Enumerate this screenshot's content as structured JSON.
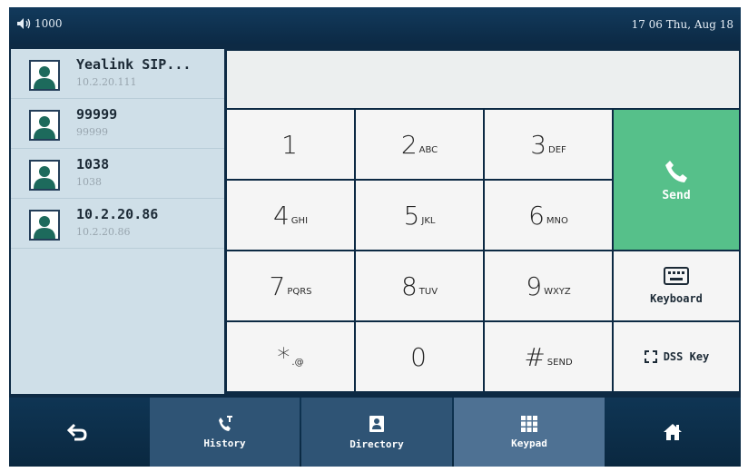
{
  "status": {
    "volume_label": "1000",
    "datetime": "17 06 Thu, Aug 18"
  },
  "contacts": [
    {
      "name": "Yealink SIP...",
      "number": "10.2.20.111"
    },
    {
      "name": "99999",
      "number": "99999"
    },
    {
      "name": "1038",
      "number": "1038"
    },
    {
      "name": "10.2.20.86",
      "number": "10.2.20.86"
    }
  ],
  "keypad": {
    "k1": {
      "digit": "1",
      "sub": ""
    },
    "k2": {
      "digit": "2",
      "sub": "ABC"
    },
    "k3": {
      "digit": "3",
      "sub": "DEF"
    },
    "k4": {
      "digit": "4",
      "sub": "GHI"
    },
    "k5": {
      "digit": "5",
      "sub": "JKL"
    },
    "k6": {
      "digit": "6",
      "sub": "MNO"
    },
    "k7": {
      "digit": "7",
      "sub": "PQRS"
    },
    "k8": {
      "digit": "8",
      "sub": "TUV"
    },
    "k9": {
      "digit": "9",
      "sub": "WXYZ"
    },
    "kstar": {
      "digit": "*",
      "sub": ".@"
    },
    "k0": {
      "digit": "0",
      "sub": ""
    },
    "khash": {
      "digit": "#",
      "sub": "SEND"
    }
  },
  "actions": {
    "send": "Send",
    "keyboard": "Keyboard",
    "dss": "DSS Key"
  },
  "nav": {
    "history": "History",
    "directory": "Directory",
    "keypad": "Keypad"
  },
  "colors": {
    "send": "#56c08a",
    "frame": "#0d2a44",
    "active_tab": "#4e7193"
  },
  "icons": {
    "back": "back-arrow-icon",
    "home": "home-icon",
    "history": "history-icon",
    "directory": "directory-icon",
    "keypad": "keypad-grid-icon"
  }
}
